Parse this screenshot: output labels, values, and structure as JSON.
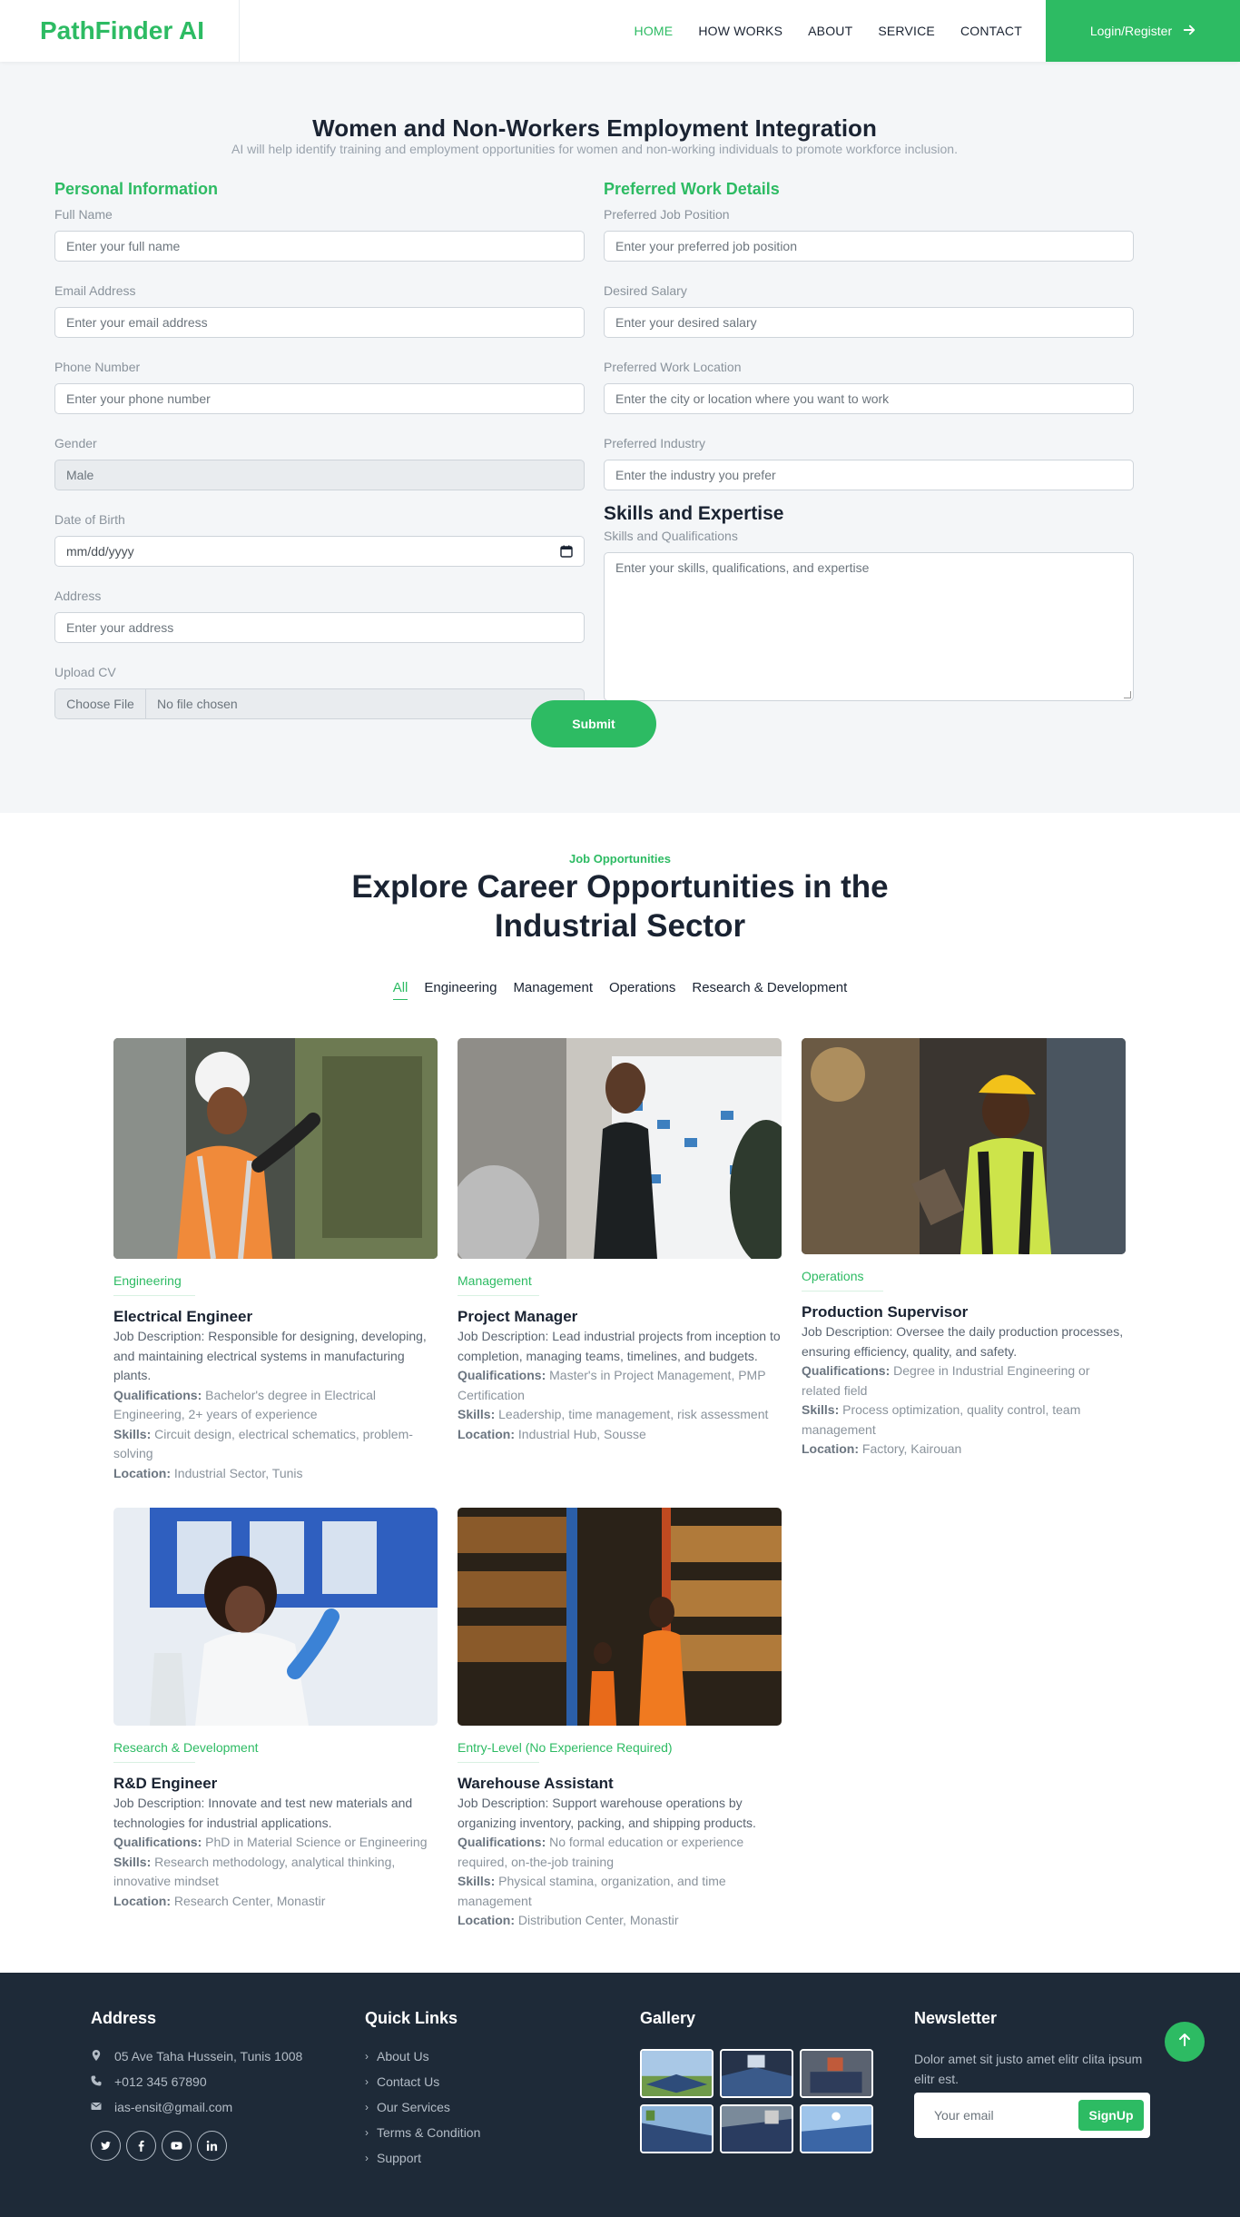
{
  "brand": "PathFinder AI",
  "nav": {
    "items": [
      "HOME",
      "HOW WORKS",
      "ABOUT",
      "SERVICE",
      "CONTACT"
    ],
    "active": "HOME",
    "login": "Login/Register"
  },
  "form": {
    "title": "Women and Non-Workers Employment Integration",
    "subtitle": "AI will help identify training and employment opportunities for women and non-working individuals to promote workforce inclusion.",
    "personal_heading": "Personal Information",
    "preferred_heading": "Preferred Work Details",
    "skills_heading": "Skills and Expertise",
    "fields": {
      "full_name": {
        "label": "Full Name",
        "placeholder": "Enter your full name"
      },
      "email": {
        "label": "Email Address",
        "placeholder": "Enter your email address"
      },
      "phone": {
        "label": "Phone Number",
        "placeholder": "Enter your phone number"
      },
      "gender": {
        "label": "Gender",
        "value": "Male"
      },
      "dob": {
        "label": "Date of Birth",
        "placeholder": "mm/dd/yyyy"
      },
      "address": {
        "label": "Address",
        "placeholder": "Enter your address"
      },
      "cv": {
        "label": "Upload CV",
        "button": "Choose File",
        "status": "No file chosen"
      },
      "job_position": {
        "label": "Preferred Job Position",
        "placeholder": "Enter your preferred job position"
      },
      "salary": {
        "label": "Desired Salary",
        "placeholder": "Enter your desired salary"
      },
      "location": {
        "label": "Preferred Work Location",
        "placeholder": "Enter the city or location where you want to work"
      },
      "industry": {
        "label": "Preferred Industry",
        "placeholder": "Enter the industry you prefer"
      },
      "skills": {
        "label": "Skills and Qualifications",
        "placeholder": "Enter your skills, qualifications, and expertise"
      }
    },
    "submit": "Submit"
  },
  "jobs": {
    "eyebrow": "Job Opportunities",
    "title": "Explore Career Opportunities in the Industrial Sector",
    "filters": [
      "All",
      "Engineering",
      "Management",
      "Operations",
      "Research & Development"
    ],
    "active_filter": "All",
    "labels": {
      "desc": "Job Description:",
      "qual": "Qualifications:",
      "skills": "Skills:",
      "location": "Location:"
    },
    "cards": [
      {
        "category": "Engineering",
        "title": "Electrical Engineer",
        "description": "Responsible for designing, developing, and maintaining electrical systems in manufacturing plants.",
        "qualifications": "Bachelor's degree in Electrical Engineering, 2+ years of experience",
        "skills": "Circuit design, electrical schematics, problem-solving",
        "location": "Industrial Sector, Tunis"
      },
      {
        "category": "Management",
        "title": "Project Manager",
        "description": "Lead industrial projects from inception to completion, managing teams, timelines, and budgets.",
        "qualifications": "Master's in Project Management, PMP Certification",
        "skills": "Leadership, time management, risk assessment",
        "location": "Industrial Hub, Sousse"
      },
      {
        "category": "Operations",
        "title": "Production Supervisor",
        "description": "Oversee the daily production processes, ensuring efficiency, quality, and safety.",
        "qualifications": "Degree in Industrial Engineering or related field",
        "skills": "Process optimization, quality control, team management",
        "location": "Factory, Kairouan"
      },
      {
        "category": "Research & Development",
        "title": "R&D Engineer",
        "description": "Innovate and test new materials and technologies for industrial applications.",
        "qualifications": "PhD in Material Science or Engineering",
        "skills": "Research methodology, analytical thinking, innovative mindset",
        "location": "Research Center, Monastir"
      },
      {
        "category": "Entry-Level (No Experience Required)",
        "title": "Warehouse Assistant",
        "description": "Support warehouse operations by organizing inventory, packing, and shipping products.",
        "qualifications": "No formal education or experience required, on-the-job training",
        "skills": "Physical stamina, organization, and time management",
        "location": "Distribution Center, Monastir"
      }
    ]
  },
  "footer": {
    "address_heading": "Address",
    "address": "05 Ave Taha Hussein, Tunis 1008",
    "phone": "+012 345 67890",
    "email": "ias-ensit@gmail.com",
    "links_heading": "Quick Links",
    "links": [
      "About Us",
      "Contact Us",
      "Our Services",
      "Terms & Condition",
      "Support"
    ],
    "gallery_heading": "Gallery",
    "newsletter_heading": "Newsletter",
    "newsletter_text": "Dolor amet sit justo amet elitr clita ipsum elitr est.",
    "newsletter_placeholder": "Your email",
    "signup": "SignUp"
  },
  "colors": {
    "accent": "#2dbb63",
    "dark": "#1a2332",
    "footer": "#1e2a38"
  }
}
